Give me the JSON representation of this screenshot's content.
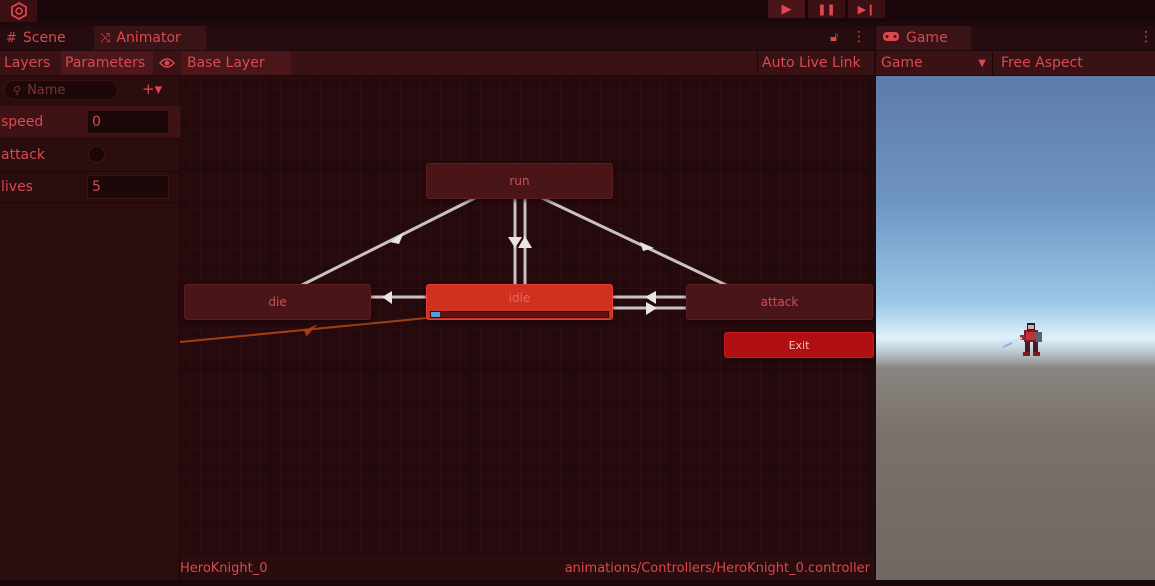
{
  "toolbar": {
    "play_icon": "▶",
    "pause_icon": "❚❚",
    "step_icon": "▶❙"
  },
  "tabs": {
    "scene": {
      "label": "Scene",
      "icon": "#"
    },
    "animator": {
      "label": "Animator",
      "icon": "⤨"
    },
    "game": {
      "label": "Game",
      "icon": "🎮"
    }
  },
  "animator_toolbar": {
    "layers": "Layers",
    "parameters": "Parameters",
    "breadcrumb": "Base Layer",
    "auto_live_link": "Auto Live Link",
    "search_placeholder": "Name",
    "add_icon": "+▾"
  },
  "parameters": [
    {
      "name": "speed",
      "type": "float",
      "value": "0"
    },
    {
      "name": "attack",
      "type": "trigger",
      "value": ""
    },
    {
      "name": "lives",
      "type": "int",
      "value": "5"
    }
  ],
  "states": {
    "run": "run",
    "die": "die",
    "idle": "idle",
    "attack": "attack",
    "exit": "Exit",
    "idle_progress": 0.05
  },
  "status": {
    "controller": "HeroKnight_0",
    "path": "animations/Controllers/HeroKnight_0.controller"
  },
  "game": {
    "display": "Game",
    "aspect": "Free Aspect"
  },
  "colors": {
    "accent": "#d84a4e",
    "active_state": "#d0301f",
    "exit_state": "#b01014"
  }
}
